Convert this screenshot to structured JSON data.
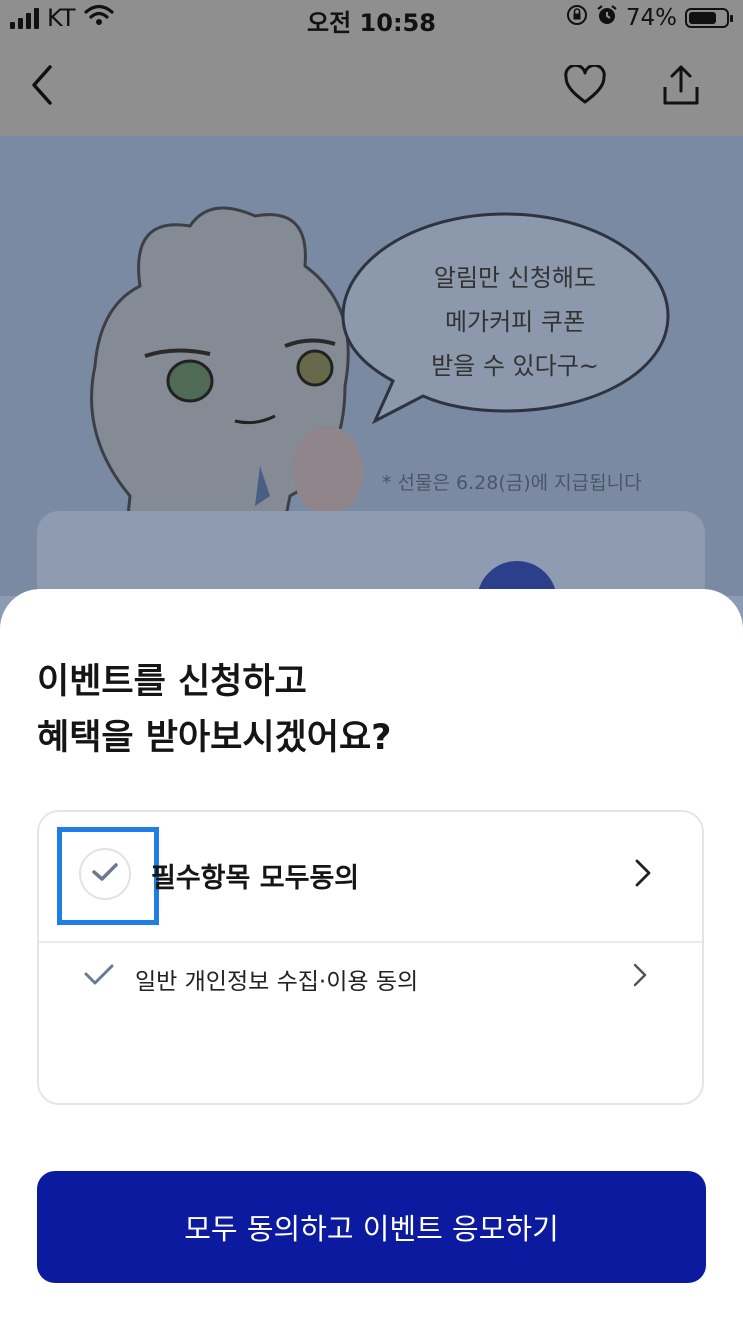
{
  "status_bar": {
    "carrier": "KT",
    "time": "오전 10:58",
    "battery": "74%",
    "battery_level": 0.74
  },
  "nav": {
    "back_icon": "chevron-left-icon",
    "like_icon": "heart-icon",
    "share_icon": "share-icon"
  },
  "banner": {
    "speech_line1": "알림만 신청해도",
    "speech_line2": "메가커피 쿠폰",
    "speech_line3": "받을 수 있다구~",
    "notice": "* 선물은 6.28(금)에 지급됩니다"
  },
  "sheet": {
    "title_line1": "이벤트를 신청하고",
    "title_line2": "혜택을 받아보시겠어요?",
    "agree_all_label": "필수항목 모두동의",
    "terms": [
      {
        "label": "일반 개인정보 수집·이용 동의"
      }
    ],
    "cta_label": "모두 동의하고 이벤트 응모하기"
  },
  "colors": {
    "accent": "#0b1a9e",
    "focus": "#1f7ee6",
    "check": "#6c7a90"
  }
}
